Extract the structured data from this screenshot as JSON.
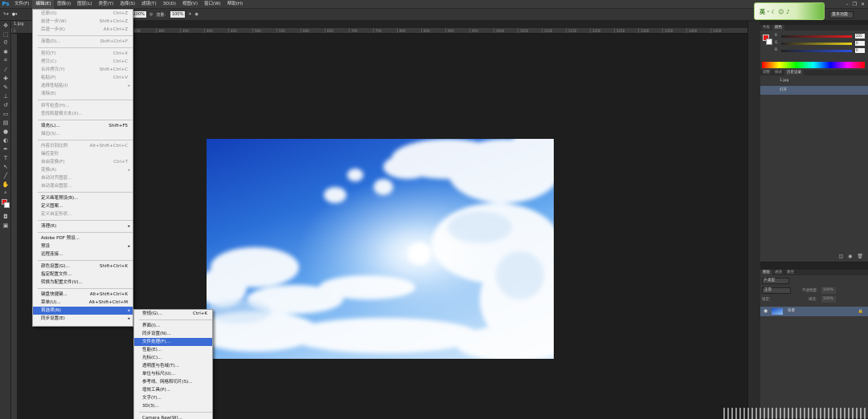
{
  "app": {
    "logo": "Ps"
  },
  "menubar": [
    {
      "label": "文件(F)"
    },
    {
      "label": "编辑(E)",
      "active": true
    },
    {
      "label": "图像(I)"
    },
    {
      "label": "图层(L)"
    },
    {
      "label": "类型(Y)"
    },
    {
      "label": "选择(S)"
    },
    {
      "label": "滤镜(T)"
    },
    {
      "label": "3D(D)"
    },
    {
      "label": "视图(V)"
    },
    {
      "label": "窗口(W)"
    },
    {
      "label": "帮助(H)"
    }
  ],
  "window_controls": [
    "–",
    "❐",
    "✕"
  ],
  "options": {
    "opacity_value": "100%",
    "flow_label": "流量:",
    "flow_value": "100%"
  },
  "workspace": "基本功能",
  "badge": {
    "text": "英 · ☾ ☺ ♪"
  },
  "doc_tab": "1.jpg",
  "ruler": [
    "0",
    "50",
    "100",
    "150",
    "200",
    "250",
    "300",
    "350",
    "400",
    "450",
    "500",
    "550",
    "600",
    "650",
    "700",
    "750",
    "800",
    "850",
    "900",
    "950",
    "1000",
    "1050",
    "1100",
    "1150",
    "1200",
    "1250",
    "1300",
    "1350",
    "1400",
    "1450"
  ],
  "edit_menu": [
    {
      "label": "还原(O)",
      "shortcut": "Ctrl+Z",
      "disabled": true
    },
    {
      "label": "前进一步(W)",
      "shortcut": "Shift+Ctrl+Z",
      "disabled": true
    },
    {
      "label": "后退一步(K)",
      "shortcut": "Alt+Ctrl+Z",
      "disabled": true
    },
    {
      "sep": true
    },
    {
      "label": "渐隐(D)...",
      "shortcut": "Shift+Ctrl+F",
      "disabled": true
    },
    {
      "sep": true
    },
    {
      "label": "剪切(T)",
      "shortcut": "Ctrl+X",
      "disabled": true
    },
    {
      "label": "拷贝(C)",
      "shortcut": "Ctrl+C",
      "disabled": true
    },
    {
      "label": "合并拷贝(Y)",
      "shortcut": "Shift+Ctrl+C",
      "disabled": true
    },
    {
      "label": "粘贴(P)",
      "shortcut": "Ctrl+V",
      "disabled": true
    },
    {
      "label": "选择性粘贴(I)",
      "arrow": true,
      "disabled": true
    },
    {
      "label": "清除(E)",
      "disabled": true
    },
    {
      "sep": true
    },
    {
      "label": "拼写检查(H)...",
      "disabled": true
    },
    {
      "label": "查找和替换文本(X)...",
      "disabled": true
    },
    {
      "sep": true
    },
    {
      "label": "填充(L)...",
      "shortcut": "Shift+F5"
    },
    {
      "label": "描边(S)...",
      "disabled": true
    },
    {
      "sep": true
    },
    {
      "label": "内容识别比例",
      "shortcut": "Alt+Shift+Ctrl+C",
      "disabled": true
    },
    {
      "label": "操控变形",
      "disabled": true
    },
    {
      "label": "自由变换(F)",
      "shortcut": "Ctrl+T",
      "disabled": true
    },
    {
      "label": "变换(A)",
      "arrow": true,
      "disabled": true
    },
    {
      "label": "自动对齐图层...",
      "disabled": true
    },
    {
      "label": "自动混合图层...",
      "disabled": true
    },
    {
      "sep": true
    },
    {
      "label": "定义画笔预设(B)..."
    },
    {
      "label": "定义图案..."
    },
    {
      "label": "定义自定形状...",
      "disabled": true
    },
    {
      "sep": true
    },
    {
      "label": "清理(R)",
      "arrow": true
    },
    {
      "sep": true
    },
    {
      "label": "Adobe PDF 预设..."
    },
    {
      "label": "预设",
      "arrow": true
    },
    {
      "label": "远程连接..."
    },
    {
      "sep": true
    },
    {
      "label": "颜色设置(G)...",
      "shortcut": "Shift+Ctrl+K"
    },
    {
      "label": "指定配置文件..."
    },
    {
      "label": "转换为配置文件(V)..."
    },
    {
      "sep": true
    },
    {
      "label": "键盘快捷键...",
      "shortcut": "Alt+Shift+Ctrl+K"
    },
    {
      "label": "菜单(U)...",
      "shortcut": "Alt+Shift+Ctrl+M"
    },
    {
      "label": "首选项(N)",
      "arrow": true,
      "highlight": true
    },
    {
      "label": "同步设置(E)",
      "arrow": true
    }
  ],
  "prefs_menu": [
    {
      "label": "常规(G)...",
      "shortcut": "Ctrl+K"
    },
    {
      "sep": true
    },
    {
      "label": "界面(I)..."
    },
    {
      "label": "同步设置(N)..."
    },
    {
      "label": "文件处理(F)...",
      "highlight": true
    },
    {
      "label": "性能(E)..."
    },
    {
      "label": "光标(C)..."
    },
    {
      "label": "透明度与色域(T)..."
    },
    {
      "label": "单位与标尺(U)..."
    },
    {
      "label": "参考线、网格和切片(S)..."
    },
    {
      "label": "增效工具(P)..."
    },
    {
      "label": "文字(Y)..."
    },
    {
      "label": "3D(3)..."
    },
    {
      "sep": true
    },
    {
      "label": "Camera Raw(W)..."
    }
  ],
  "color_panel": {
    "tabs": [
      "色板",
      "颜色"
    ],
    "sliders": [
      {
        "label": "R",
        "value": "255",
        "color": "#e21b1b"
      },
      {
        "label": "G",
        "value": "0",
        "color": "#e8d01a"
      },
      {
        "label": "B",
        "value": "0",
        "color": "#2a4fe0"
      }
    ]
  },
  "history_panel": {
    "tabs": [
      "调整",
      "样式",
      "历史记录"
    ],
    "rows": [
      {
        "label": "1.jpg",
        "selected": false
      },
      {
        "label": "打开",
        "selected": true
      }
    ]
  },
  "layers_panel": {
    "tabs": [
      "图层",
      "通道",
      "路径"
    ],
    "kind": "P 类型",
    "blend": "正常",
    "opacity_label": "不透明度:",
    "opacity": "100%",
    "lock_label": "锁定:",
    "fill_label": "填充:",
    "fill": "100%",
    "layer": "背景"
  },
  "colors": {
    "fg": "#e21b1b",
    "bg": "#ffffff",
    "highlight": "#3b6bd4"
  }
}
